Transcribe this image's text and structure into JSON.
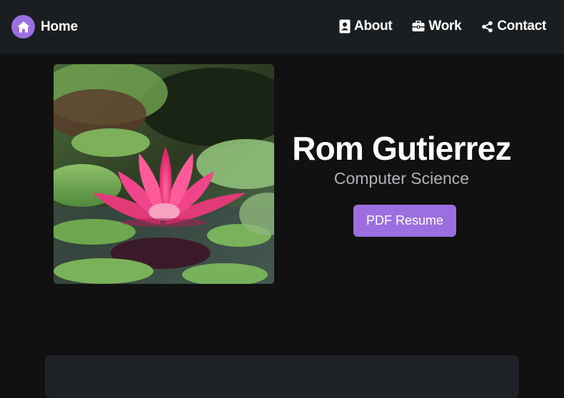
{
  "navbar": {
    "brand": {
      "label": "Home",
      "icon": "home-icon",
      "icon_bg": "#9b6fe0"
    },
    "links": [
      {
        "label": "About",
        "icon": "contact-card-icon"
      },
      {
        "label": "Work",
        "icon": "briefcase-icon"
      },
      {
        "label": "Contact",
        "icon": "share-icon"
      }
    ]
  },
  "hero": {
    "image": "pink-lotus-flower-photo",
    "name": "Rom Gutierrez",
    "subtitle": "Computer Science",
    "resume_button": "PDF Resume"
  },
  "colors": {
    "accent": "#9b6fe0",
    "background": "#111111",
    "navbar": "#1b1e21",
    "subtitle": "#aeb3b8"
  }
}
